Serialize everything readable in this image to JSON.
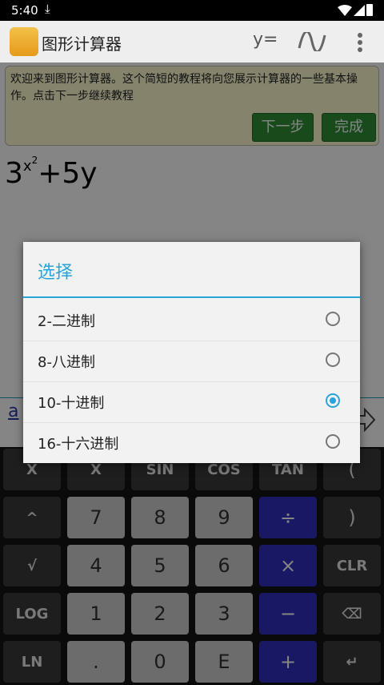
{
  "status": {
    "time": "5:40",
    "download_icon": "download-icon"
  },
  "app": {
    "title": "图形计算器",
    "y_button": "y=",
    "graph_icon": "wave-icon",
    "menu_icon": "more-vert-icon"
  },
  "tutorial": {
    "text": "欢迎来到图形计算器。这个简短的教程将向您展示计算器的一些基本操作。点击下一步继续教程",
    "next_label": "下一步",
    "done_label": "完成"
  },
  "expression": {
    "base": "3",
    "exp_base": "x",
    "exp_exp": "2",
    "rest": "+5y"
  },
  "input": {
    "value": "a"
  },
  "keypad": {
    "rows": [
      [
        "X",
        "X",
        "SIN",
        "COS",
        "TAN",
        "("
      ],
      [
        "^",
        "7",
        "8",
        "9",
        "÷",
        ")"
      ],
      [
        "√",
        "4",
        "5",
        "6",
        "×",
        "CLR"
      ],
      [
        "LOG",
        "1",
        "2",
        "3",
        "−",
        "⌫"
      ],
      [
        "LN",
        ".",
        "0",
        "E",
        "+",
        "↵"
      ]
    ]
  },
  "dialog": {
    "title": "选择",
    "options": [
      {
        "label": "2-二进制",
        "selected": false
      },
      {
        "label": "8-八进制",
        "selected": false
      },
      {
        "label": "10-十进制",
        "selected": true
      },
      {
        "label": "16-十六进制",
        "selected": false
      }
    ]
  }
}
